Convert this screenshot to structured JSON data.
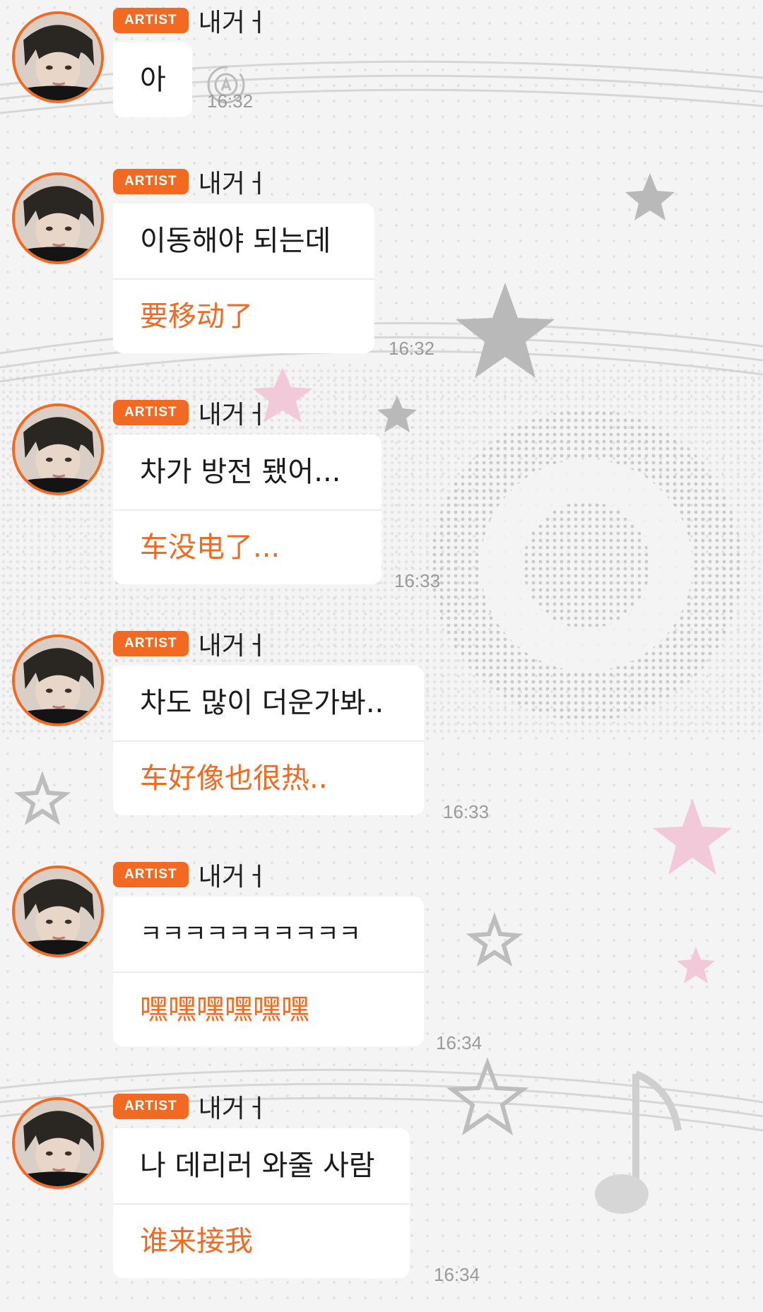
{
  "badge_label": "ARTIST",
  "accent_color": "#f26a21",
  "icons": {
    "translate": "translate-icon",
    "avatar": "avatar"
  },
  "messages": [
    {
      "sender": "내거ㅓ",
      "original": "아",
      "translation": "",
      "time": "16:32"
    },
    {
      "sender": "내거ㅓ",
      "original": "이동해야 되는데",
      "translation": "要移动了",
      "time": "16:32"
    },
    {
      "sender": "내거ㅓ",
      "original": "차가 방전 됐어...",
      "translation": "车没电了...",
      "time": "16:33"
    },
    {
      "sender": "내거ㅓ",
      "original": "차도 많이 더운가봐..",
      "translation": "车好像也很热..",
      "time": "16:33"
    },
    {
      "sender": "내거ㅓ",
      "original": "ㅋㅋㅋㅋㅋㅋㅋㅋㅋㅋ",
      "translation": "嘿嘿嘿嘿嘿嘿",
      "time": "16:34"
    },
    {
      "sender": "내거ㅓ",
      "original": "나 데리러 와줄 사람",
      "translation": "谁来接我",
      "time": "16:34"
    }
  ]
}
